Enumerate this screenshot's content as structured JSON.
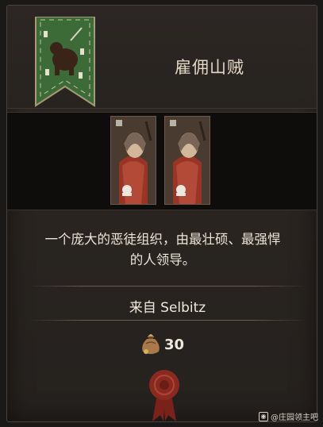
{
  "unit": {
    "name": "雇佣山贼",
    "description_line1": "一个庞大的恶徒组织，由最壮硕、最强悍",
    "description_line2": "的人领导。",
    "origin": "来自 Selbitz",
    "cost": "30"
  },
  "icons": {
    "banner": "bear-heraldic-banner-icon",
    "portrait": "bandit-crossbowman-portrait",
    "cost": "money-bag-icon",
    "seal": "wax-seal-icon"
  },
  "colors": {
    "banner_green": "#3d6b37",
    "seal_red": "#8a2a1f",
    "text": "#ece5d8"
  },
  "watermark": {
    "text": "@庄园领主吧"
  }
}
